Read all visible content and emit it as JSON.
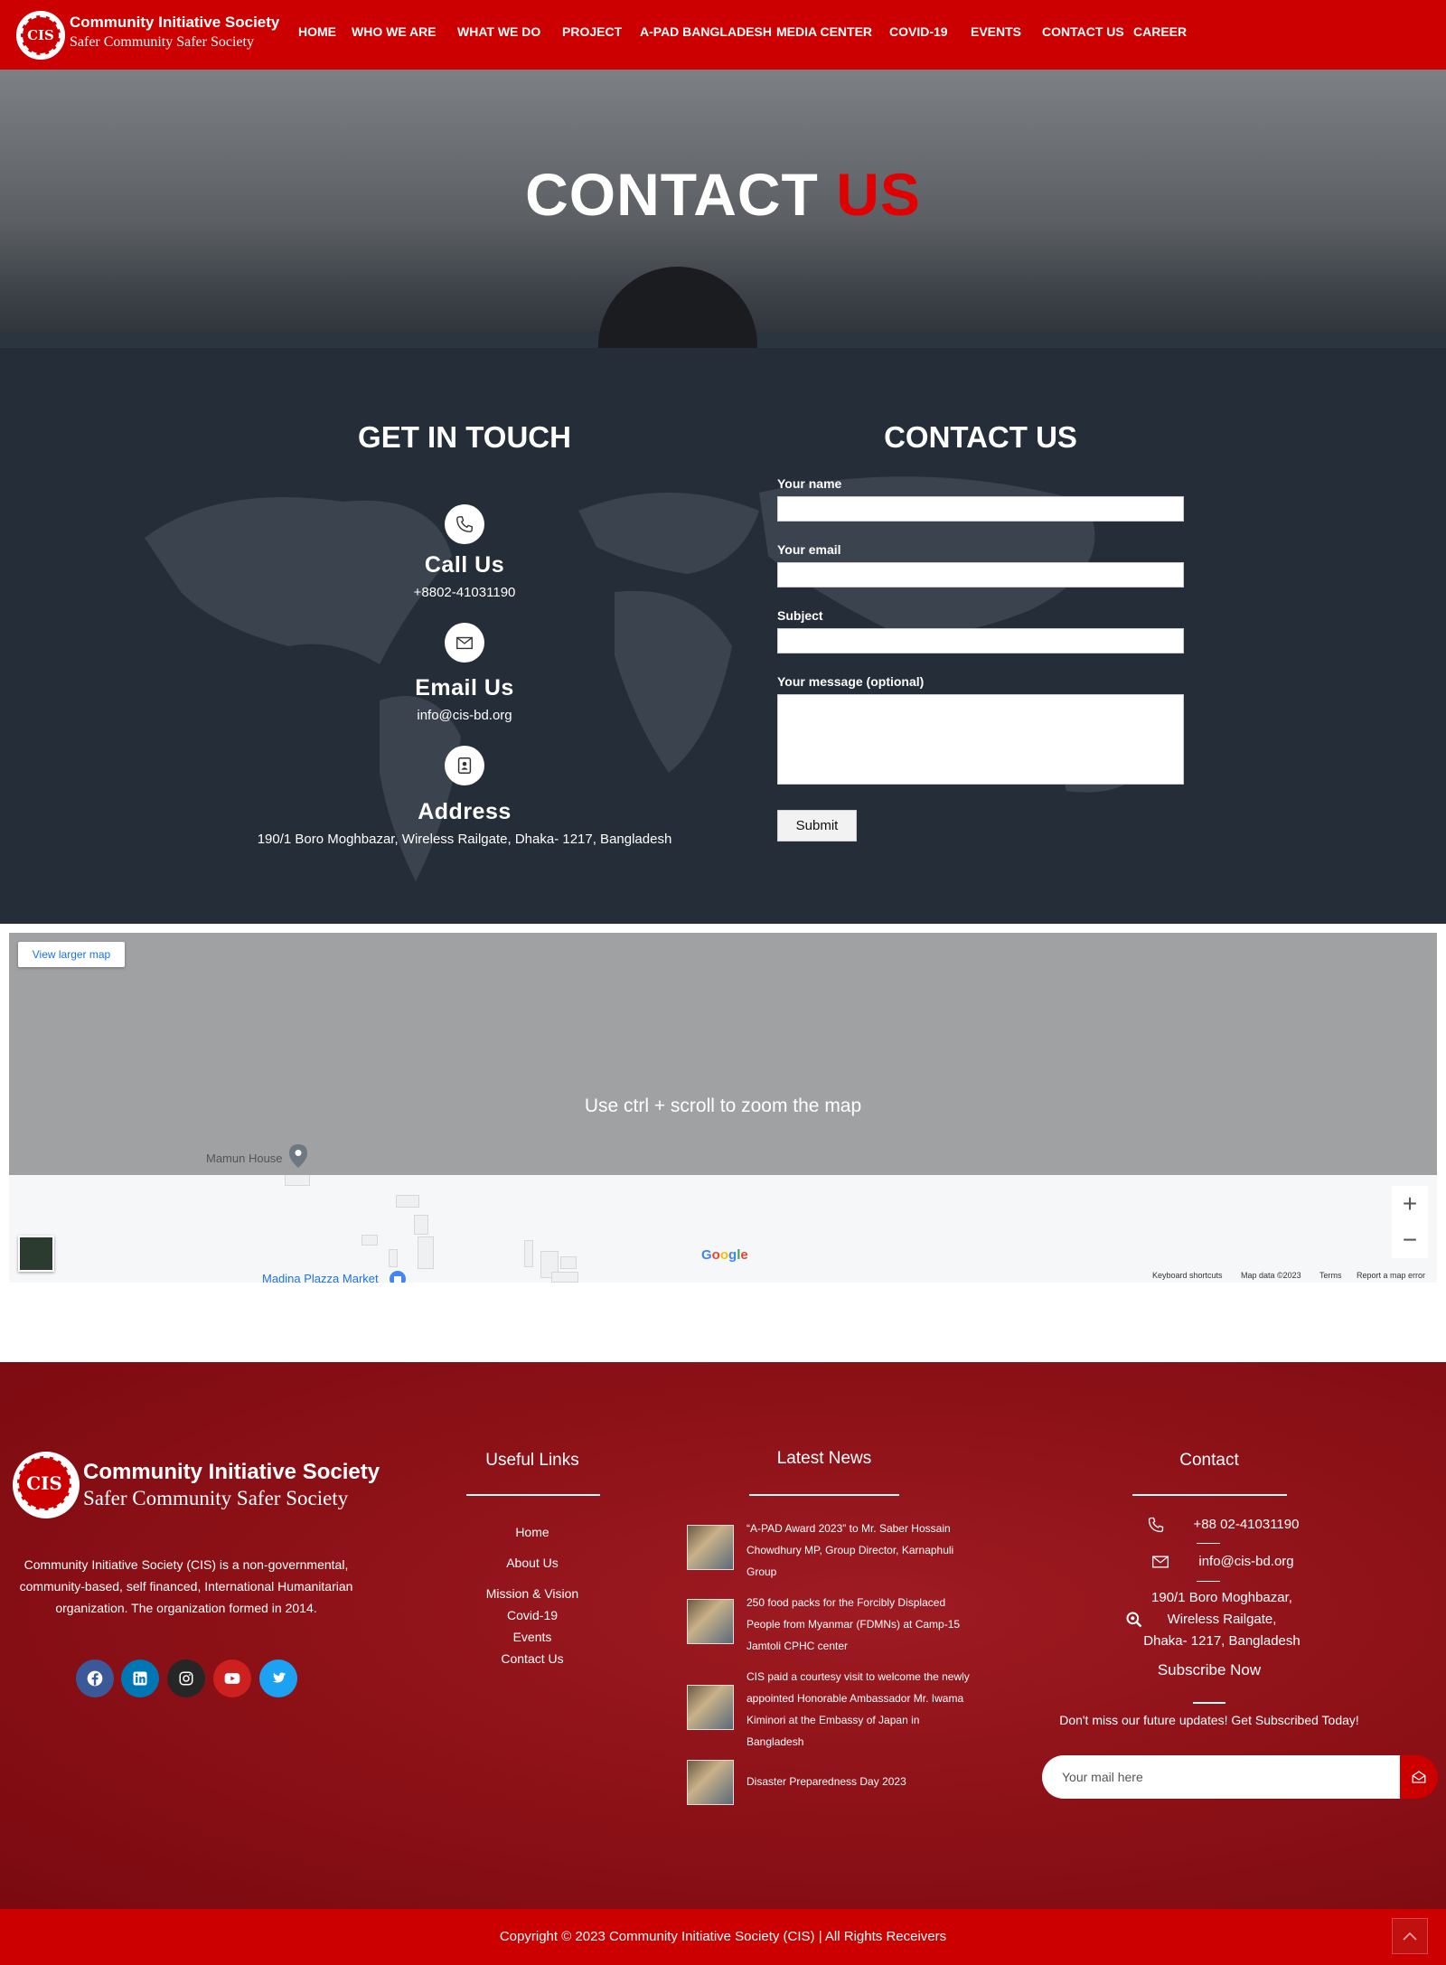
{
  "header": {
    "brand_title": "Community Initiative Society",
    "brand_subtitle": "Safer Community Safer Society",
    "logo_text": "CIS",
    "nav": [
      "HOME",
      "WHO WE ARE",
      "WHAT WE DO",
      "PROJECT",
      "A-PAD BANGLADESH",
      "MEDIA CENTER",
      "COVID-19",
      "EVENTS",
      "CONTACT US",
      "CAREER"
    ]
  },
  "hero": {
    "title_main": "CONTACT",
    "title_accent": "US"
  },
  "get_in_touch": {
    "title": "GET IN TOUCH",
    "call_label": "Call Us",
    "call_value": "+8802-41031190",
    "email_label": "Email Us",
    "email_value": "info@cis-bd.org",
    "address_label": "Address",
    "address_value": "190/1 Boro Moghbazar, Wireless Railgate, Dhaka- 1217, Bangladesh"
  },
  "contact_form": {
    "title": "CONTACT US",
    "name_label": "Your name",
    "email_label": "Your email",
    "subject_label": "Subject",
    "message_label": "Your message (optional)",
    "submit_label": "Submit"
  },
  "map": {
    "view_larger": "View larger map",
    "overlay_text": "Use ctrl + scroll to zoom the map",
    "place_1": "Mamun House",
    "place_2": "Madina Plazza Market",
    "google": "Google",
    "zoom_in": "+",
    "zoom_out": "−",
    "footer_links": [
      "Keyboard shortcuts",
      "Map data ©2023",
      "Terms",
      "Report a map error"
    ]
  },
  "footer": {
    "brand_title": "Community Initiative Society",
    "brand_subtitle": "Safer Community Safer Society",
    "logo_text": "CIS",
    "about": "Community Initiative Society (CIS) is a non-governmental, community-based, self financed, International Humanitarian organization. The organization formed in 2014.",
    "social": [
      {
        "name": "facebook-icon",
        "color": "#3b5998"
      },
      {
        "name": "linkedin-icon",
        "color": "#0077b5"
      },
      {
        "name": "instagram-icon",
        "color": "#262626"
      },
      {
        "name": "youtube-icon",
        "color": "#cd201f"
      },
      {
        "name": "twitter-icon",
        "color": "#1da1f2"
      }
    ],
    "useful_links_title": "Useful Links",
    "useful_links": [
      "Home",
      "About Us",
      "Mission & Vision",
      "Covid-19",
      "Events",
      "Contact Us"
    ],
    "news_title": "Latest News",
    "news": [
      "“A-PAD Award 2023” to Mr. Saber Hossain Chowdhury MP, Group Director, Karnaphuli Group",
      "250 food packs for the Forcibly Displaced People from Myanmar (FDMNs) at Camp-15 Jamtoli CPHC center",
      "CIS paid a courtesy visit to welcome the newly appointed Honorable Ambassador Mr. Iwama Kiminori at the Embassy of Japan in Bangladesh",
      "Disaster Preparedness Day 2023"
    ],
    "contact_title": "Contact",
    "phone": "+88 02-41031190",
    "email": "info@cis-bd.org",
    "address_line_1": "190/1 Boro Moghbazar,",
    "address_line_2": "Wireless Railgate,",
    "address_line_3": "Dhaka- 1217, Bangladesh",
    "subscribe_title": "Subscribe Now",
    "subscribe_text": "Don't miss our future updates! Get Subscribed Today!",
    "subscribe_placeholder": "Your mail here",
    "copyright": "Copyright © 2023 Community Initiative Society (CIS) | All Rights Receivers"
  }
}
